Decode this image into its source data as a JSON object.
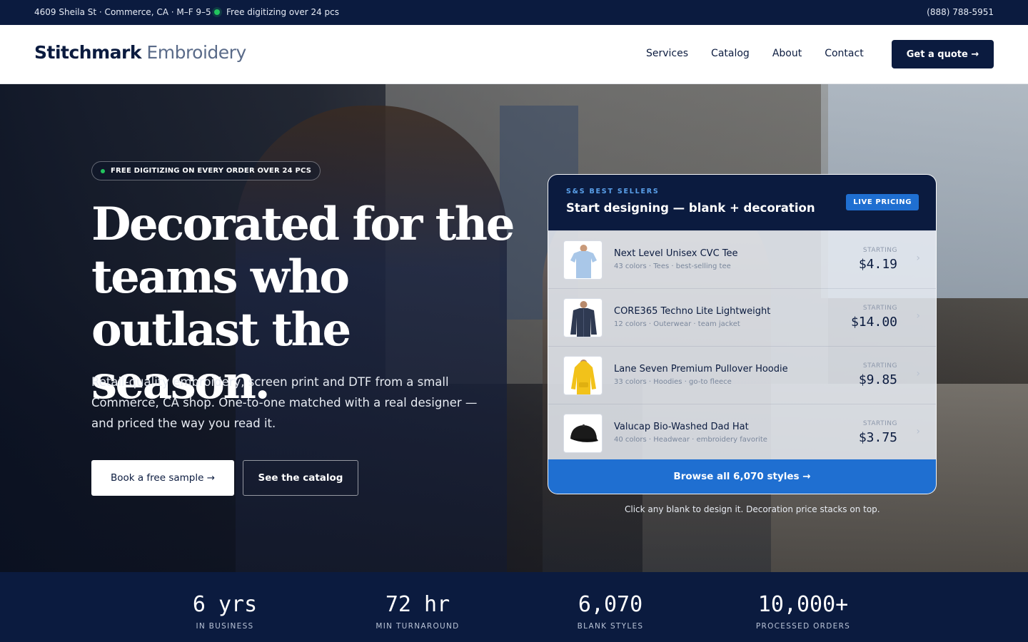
{
  "topbar": {
    "address": "4609 Sheila St · Commerce, CA · M–F 9–5",
    "promo": "Free digitizing over 24 pcs",
    "phone": "(888) 788-5951"
  },
  "header": {
    "logo_primary": "Stitchmark",
    "logo_secondary": "Embroidery",
    "nav": [
      "Services",
      "Catalog",
      "About",
      "Contact"
    ],
    "cta": "Get a quote →"
  },
  "hero": {
    "badge": "FREE DIGITIZING ON EVERY ORDER OVER 24 PCS",
    "headline": "Decorated for the teams who outlast the season.",
    "subtext": "Retail-quality embroidery, screen print and DTF from a small Commerce, CA shop. One-to-one matched with a real designer — and priced the way you read it.",
    "primary_button": "Book a free sample →",
    "secondary_button": "See the catalog"
  },
  "card": {
    "kicker": "S&S BEST SELLERS",
    "title": "Start designing — blank + decoration",
    "live_badge": "LIVE PRICING",
    "price_label": "STARTING",
    "products": [
      {
        "name": "Next Level Unisex CVC Tee",
        "meta": "43 colors · Tees · best-selling tee",
        "price": "$4.19",
        "icon": "tshirt-icon",
        "color": "#a9c7e8"
      },
      {
        "name": "CORE365 Techno Lite Lightweight",
        "meta": "12 colors · Outerwear · team jacket",
        "price": "$14.00",
        "icon": "jacket-icon",
        "color": "#2f3a52"
      },
      {
        "name": "Lane Seven Premium Pullover Hoodie",
        "meta": "33 colors · Hoodies · go-to fleece",
        "price": "$9.85",
        "icon": "hoodie-icon",
        "color": "#f2c21a"
      },
      {
        "name": "Valucap Bio-Washed Dad Hat",
        "meta": "40 colors · Headwear · embroidery favorite",
        "price": "$3.75",
        "icon": "cap-icon",
        "color": "#1a1a1a"
      }
    ],
    "browse": "Browse all 6,070 styles →",
    "note": "Click any blank to design it. Decoration price stacks on top."
  },
  "stats": [
    {
      "value": "6 yrs",
      "label": "IN BUSINESS"
    },
    {
      "value": "72 hr",
      "label": "MIN TURNAROUND"
    },
    {
      "value": "6,070",
      "label": "BLANK STYLES"
    },
    {
      "value": "10,000+",
      "label": "PROCESSED ORDERS"
    }
  ],
  "colors": {
    "navy": "#0b1b3f",
    "accent_blue": "#1f6fd1",
    "status_green": "#22c55e"
  }
}
